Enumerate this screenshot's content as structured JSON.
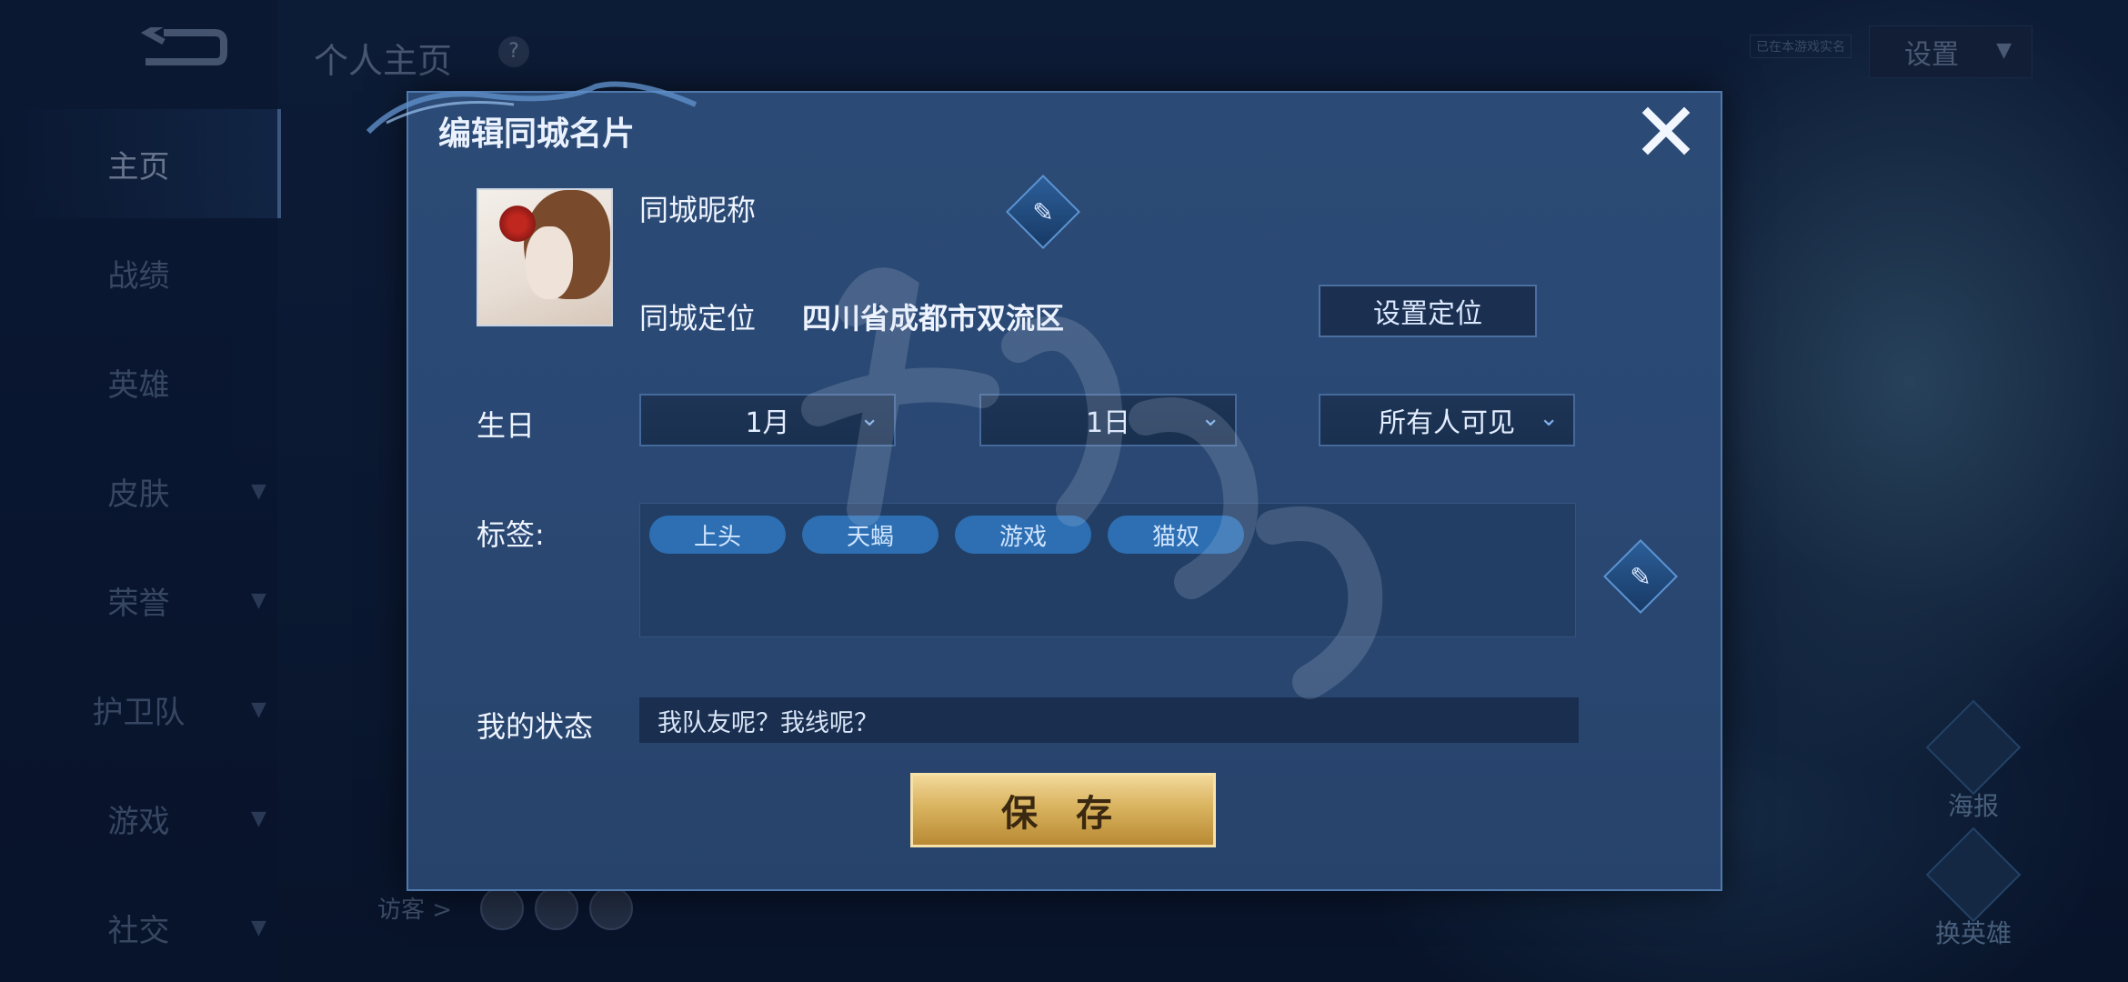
{
  "background": {
    "page_title": "个人主页",
    "help_glyph": "?",
    "tiny_label": "已在本游戏实名",
    "settings_label": "设置",
    "back_icon": "back-arrow-icon",
    "visitor_label": "访客 >",
    "side_buttons": [
      {
        "label": "海报",
        "icon": "poster-icon"
      },
      {
        "label": "换英雄",
        "icon": "swap-hero-icon"
      }
    ],
    "nav": [
      {
        "label": "主页",
        "active": true,
        "chevron": false
      },
      {
        "label": "战绩",
        "active": false,
        "chevron": false
      },
      {
        "label": "英雄",
        "active": false,
        "chevron": false
      },
      {
        "label": "皮肤",
        "active": false,
        "chevron": true
      },
      {
        "label": "荣誉",
        "active": false,
        "chevron": true
      },
      {
        "label": "护卫队",
        "active": false,
        "chevron": true
      },
      {
        "label": "游戏",
        "active": false,
        "chevron": true
      },
      {
        "label": "社交",
        "active": false,
        "chevron": true
      }
    ]
  },
  "dialog": {
    "title": "编辑同城名片",
    "close_icon": "close-icon",
    "nickname_label": "同城昵称",
    "location_label": "同城定位",
    "location_value": "四川省成都市双流区",
    "set_location_button": "设置定位",
    "birthday_label": "生日",
    "birthday_month": "1月",
    "birthday_day": "1日",
    "visibility": "所有人可见",
    "tags_label": "标签:",
    "tags": [
      "上头",
      "天蝎",
      "游戏",
      "猫奴"
    ],
    "status_label": "我的状态",
    "status_value": "我队友呢？我线呢？",
    "save_button": "保 存"
  },
  "colors": {
    "accent": "#4f79ad",
    "tag": "#2d6fb2",
    "save_gold": "#d9b35f"
  }
}
